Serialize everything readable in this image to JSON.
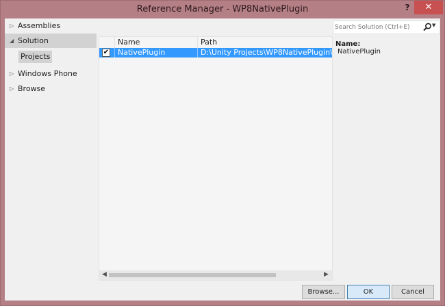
{
  "window": {
    "title": "Reference Manager - WP8NativePlugin",
    "help_label": "?",
    "close_label": "✕"
  },
  "nav": {
    "items": [
      {
        "label": "Assemblies",
        "arrow": "▷"
      },
      {
        "label": "Solution",
        "arrow": "◢"
      },
      {
        "label": "Windows Phone",
        "arrow": "▷"
      },
      {
        "label": "Browse",
        "arrow": "▷"
      }
    ],
    "sub_items": [
      {
        "label": "Projects"
      }
    ]
  },
  "search": {
    "placeholder": "Search Solution (Ctrl+E)"
  },
  "list": {
    "columns": [
      "Name",
      "Path"
    ],
    "rows": [
      {
        "checked": "✔",
        "name": "NativePlugin",
        "path": "D:\\Unity Projects\\WP8NativePlugin\\Export\\N"
      }
    ]
  },
  "details": {
    "name_label": "Name:",
    "name_value": "NativePlugin"
  },
  "buttons": {
    "browse": "Browse...",
    "ok": "OK",
    "cancel": "Cancel"
  },
  "colors": {
    "frame": "#b57f86",
    "selection": "#3399ff",
    "close": "#c75050",
    "client": "#f0f0f0"
  }
}
